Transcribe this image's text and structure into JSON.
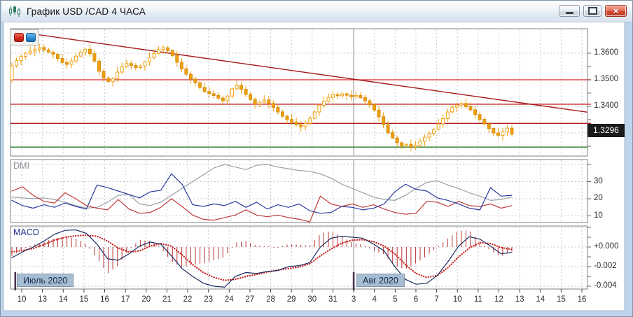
{
  "window": {
    "title": "График USD /CAD  4 ЧАСА",
    "icon": "candlestick-chart-icon",
    "controls": {
      "minimize": "minimize-icon",
      "maximize": "maximize-icon",
      "close": "close-icon",
      "close_glyph": "×"
    }
  },
  "chart_toolbar": {
    "buttons": [
      {
        "name": "red-square-button",
        "color": "#d42a1e"
      },
      {
        "name": "blue-square-button",
        "color": "#2f8fd4"
      }
    ]
  },
  "price_axis": {
    "labels": [
      "1.3600",
      "1.3500",
      "1.3400"
    ],
    "values": [
      1.36,
      1.35,
      1.34
    ],
    "current_price": "1.3296"
  },
  "x_axis": {
    "labels": [
      "10",
      "13",
      "14",
      "15",
      "16",
      "17",
      "20",
      "21",
      "22",
      "23",
      "24",
      "27",
      "28",
      "29",
      "30",
      "31",
      "3",
      "4",
      "5",
      "6",
      "7",
      "10",
      "11",
      "12",
      "13",
      "14",
      "15",
      "16"
    ],
    "month_markers": [
      {
        "label": "Июль 2020"
      },
      {
        "label": "Авг 2020"
      }
    ]
  },
  "chart_data": [
    {
      "type": "candlestick",
      "title": "USD/CAD 4 HOUR",
      "panel": "price",
      "ylim": [
        1.3213,
        1.3692
      ],
      "gridline_prices": [
        1.36,
        1.35,
        1.34,
        1.33
      ],
      "closes": [
        1.3552,
        1.3572,
        1.3588,
        1.36,
        1.3608,
        1.3615,
        1.3621,
        1.3612,
        1.3604,
        1.3596,
        1.358,
        1.3565,
        1.3558,
        1.3571,
        1.3589,
        1.3604,
        1.3615,
        1.3598,
        1.357,
        1.3532,
        1.3506,
        1.3494,
        1.3505,
        1.3529,
        1.3549,
        1.3561,
        1.3554,
        1.3546,
        1.3552,
        1.3567,
        1.3584,
        1.3599,
        1.3614,
        1.362,
        1.361,
        1.3591,
        1.3566,
        1.3541,
        1.3521,
        1.3503,
        1.3489,
        1.3471,
        1.3456,
        1.3448,
        1.3441,
        1.3431,
        1.3421,
        1.3439,
        1.3466,
        1.3479,
        1.3464,
        1.3445,
        1.3426,
        1.3409,
        1.3416,
        1.3424,
        1.3411,
        1.3396,
        1.3379,
        1.3363,
        1.3351,
        1.3341,
        1.3331,
        1.3323,
        1.3336,
        1.3355,
        1.3379,
        1.3404,
        1.3419,
        1.3434,
        1.3444,
        1.344,
        1.3447,
        1.3442,
        1.3436,
        1.3441,
        1.3433,
        1.3421,
        1.3406,
        1.3386,
        1.3361,
        1.3331,
        1.3301,
        1.3281,
        1.3263,
        1.3251,
        1.3257,
        1.3248,
        1.3254,
        1.3269,
        1.3284,
        1.3299,
        1.3314,
        1.3334,
        1.3354,
        1.3379,
        1.3397,
        1.3405,
        1.3411,
        1.3399,
        1.3387,
        1.3369,
        1.3351,
        1.3334,
        1.3317,
        1.33,
        1.3291,
        1.3304,
        1.3318,
        1.3296
      ],
      "first_open": 1.35,
      "levels": {
        "resistance": [
          {
            "price": 1.35,
            "color": "#e04848"
          },
          {
            "price": 1.3408,
            "color": "#cc2222"
          },
          {
            "price": 1.3336,
            "color": "#b51f1f"
          }
        ],
        "support": {
          "price": 1.3247,
          "color": "#1f7a1f"
        },
        "trendline": {
          "start_price": 1.3682,
          "end_price": 1.3378,
          "color": "#a61b1b"
        }
      }
    },
    {
      "type": "line",
      "title": "DMI",
      "panel": "dmi",
      "ylim": [
        6,
        43
      ],
      "yticks": [
        30,
        20,
        10
      ],
      "series": [
        {
          "name": "adx",
          "color": "#9aa0a6",
          "values": [
            21,
            20.5,
            20,
            20.5,
            19.5,
            18,
            16,
            14.5,
            15,
            18,
            22,
            22.5,
            17,
            16,
            18,
            22,
            26,
            30,
            34,
            38,
            40,
            38.5,
            37,
            39.5,
            40,
            38.5,
            37.5,
            36.5,
            36,
            34.5,
            32,
            28.5,
            26,
            23.5,
            21,
            19.5,
            19,
            22,
            26,
            29.5,
            30.5,
            28,
            26,
            23.5,
            21.5,
            19,
            19.5,
            21
          ]
        },
        {
          "name": "minus_di",
          "color": "#c03a3a",
          "values": [
            24.5,
            27,
            22,
            18.5,
            17.5,
            23.5,
            20,
            16,
            14.5,
            13.5,
            19.5,
            14,
            11.5,
            12,
            15,
            20,
            15.5,
            10.5,
            8,
            7.5,
            9,
            10.5,
            13.5,
            10.5,
            9.5,
            10.5,
            9,
            8,
            6.5,
            21.5,
            17,
            15.5,
            17,
            15,
            16.5,
            14,
            12,
            11,
            11.5,
            18.5,
            18,
            15.5,
            18.5,
            16,
            15.5,
            17,
            14.5,
            16
          ]
        },
        {
          "name": "plus_di",
          "color": "#2b3a9e",
          "values": [
            19,
            16,
            14.5,
            16.5,
            15,
            17.5,
            15.5,
            14,
            28,
            26.5,
            24.5,
            22.5,
            20.5,
            24,
            25,
            34.5,
            28.5,
            16.5,
            15.5,
            17,
            16,
            18.5,
            15,
            18,
            14,
            16.5,
            15,
            17,
            13,
            11.5,
            12,
            15.5,
            15,
            13.5,
            14.5,
            17,
            24,
            28.5,
            25.5,
            24.5,
            20.5,
            19,
            17,
            14.5,
            13.5,
            26.5,
            21.5,
            22
          ]
        }
      ]
    },
    {
      "type": "line",
      "title": "MACD",
      "panel": "macd",
      "ytick_labels": [
        "+0.000",
        "-0.002",
        "-0.004"
      ],
      "ytick_values": [
        0,
        -0.002,
        -0.004
      ],
      "series": [
        {
          "name": "macd",
          "color": "#1b2a5e",
          "values": [
            -0.0011,
            -0.0005,
            0.0,
            0.0006,
            0.0013,
            0.0017,
            0.00175,
            0.0014,
            0.0003,
            -0.0012,
            -0.00135,
            -0.0007,
            0.0001,
            0.0005,
            0.0003,
            -0.0009,
            -0.0022,
            -0.003,
            -0.0037,
            -0.004,
            -0.0041,
            -0.003,
            -0.0026,
            -0.0027,
            -0.0025,
            -0.0024,
            -0.002,
            -0.0019,
            -0.0016,
            0.0,
            0.0009,
            0.0011,
            0.001,
            0.0009,
            0.0003,
            -0.0004,
            -0.002,
            -0.0033,
            -0.0038,
            -0.0037,
            -0.0029,
            -0.0015,
            0.0001,
            0.00105,
            0.0008,
            0.0001,
            -0.0007,
            -0.00055
          ]
        },
        {
          "name": "signal",
          "color": "#cc2222",
          "style": "dotted",
          "values": [
            -0.0005,
            -0.00035,
            -0.00015,
            0.00025,
            0.0007,
            0.001,
            0.00115,
            0.0012,
            0.0011,
            0.0006,
            -0.0001,
            -0.0005,
            -0.0004,
            0.0001,
            0.00035,
            0.0001,
            -0.0008,
            -0.0018,
            -0.0026,
            -0.0031,
            -0.0034,
            -0.0033,
            -0.003,
            -0.0028,
            -0.00255,
            -0.00235,
            -0.0022,
            -0.00205,
            -0.0017,
            -0.0009,
            -0.0002,
            0.0004,
            0.0007,
            0.00075,
            0.00055,
            0.0001,
            -0.0007,
            -0.0018,
            -0.0027,
            -0.0031,
            -0.0029,
            -0.0021,
            -0.001,
            -0.0001,
            0.00045,
            0.00035,
            -5e-05,
            -0.00025
          ]
        },
        {
          "name": "histogram",
          "color": "#b83232",
          "derived": "macd-signal"
        }
      ]
    }
  ],
  "colors": {
    "candle": "#efa012",
    "candle_border": "#d98e08",
    "grid": "#c9c9c9",
    "panel_border": "#808080",
    "month_separator": "#8a8a8a",
    "month_bar": "#4a3550",
    "badge_bg": "#a7bdd2",
    "frame": "#bed4ea"
  }
}
